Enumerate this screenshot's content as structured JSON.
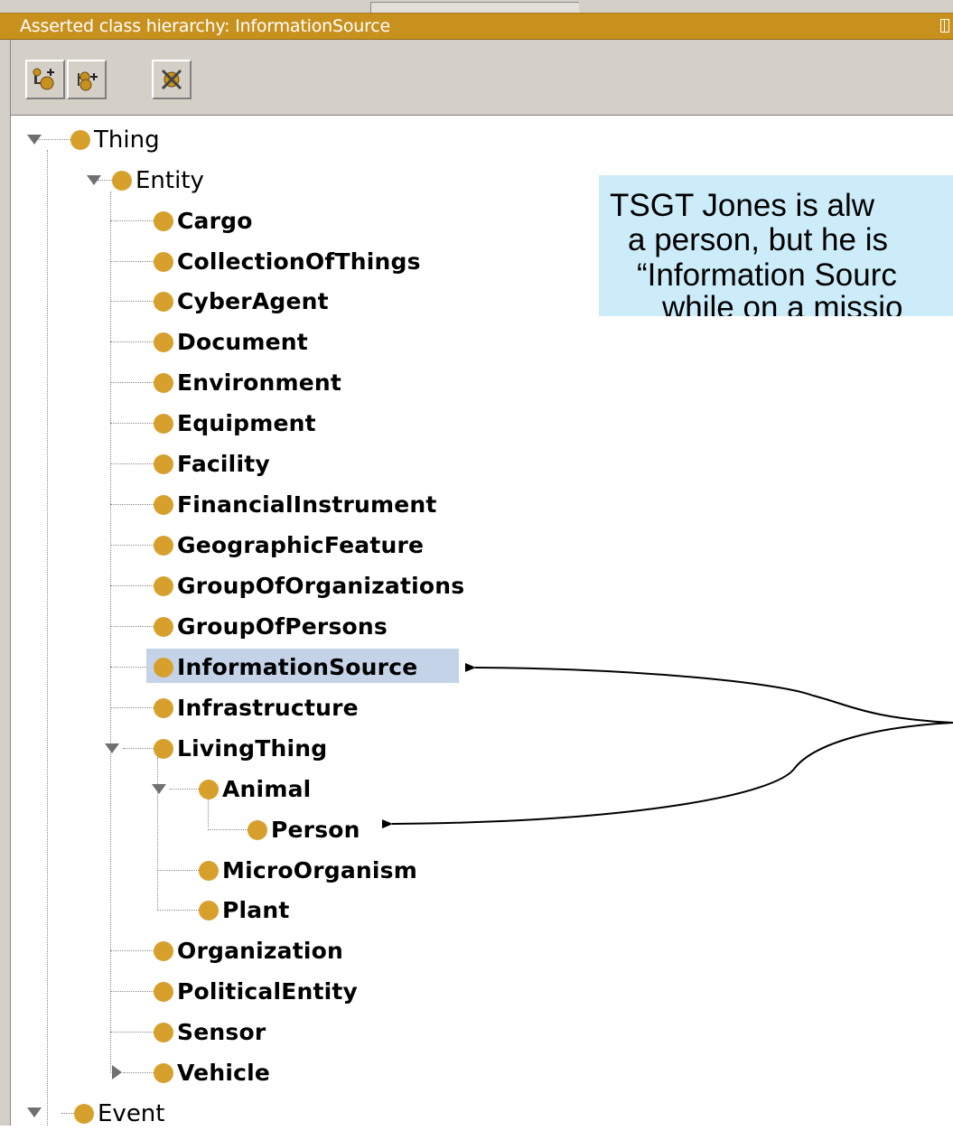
{
  "panel": {
    "title": "Asserted class hierarchy: InformationSource"
  },
  "toolbar": {
    "buttons": [
      {
        "icon": "add-subclass-icon"
      },
      {
        "icon": "add-sibling-class-icon"
      },
      {
        "icon": "delete-class-icon"
      }
    ]
  },
  "tree": {
    "thing": "Thing",
    "entity": "Entity",
    "cargo": "Cargo",
    "collection_of_things": "CollectionOfThings",
    "cyber_agent": "CyberAgent",
    "document": "Document",
    "environment": "Environment",
    "equipment": "Equipment",
    "facility": "Facility",
    "financial_instrument": "FinancialInstrument",
    "geographic_feature": "GeographicFeature",
    "group_of_organizations": "GroupOfOrganizations",
    "group_of_persons": "GroupOfPersons",
    "information_source": "InformationSource",
    "infrastructure": "Infrastructure",
    "living_thing": "LivingThing",
    "animal": "Animal",
    "person": "Person",
    "micro_organism": "MicroOrganism",
    "plant": "Plant",
    "organization": "Organization",
    "political_entity": "PoliticalEntity",
    "sensor": "Sensor",
    "vehicle": "Vehicle",
    "event": "Event",
    "selected": "InformationSource"
  },
  "callout": {
    "line1": "TSGT Jones is alw",
    "line2": "a person, but he is",
    "line3": "“Information Sourc",
    "line4": "while on a missio"
  },
  "colors": {
    "header": "#c8911e",
    "bullet": "#d7a02d",
    "selection": "#c5d3e8",
    "callout": "#ccecf9"
  }
}
